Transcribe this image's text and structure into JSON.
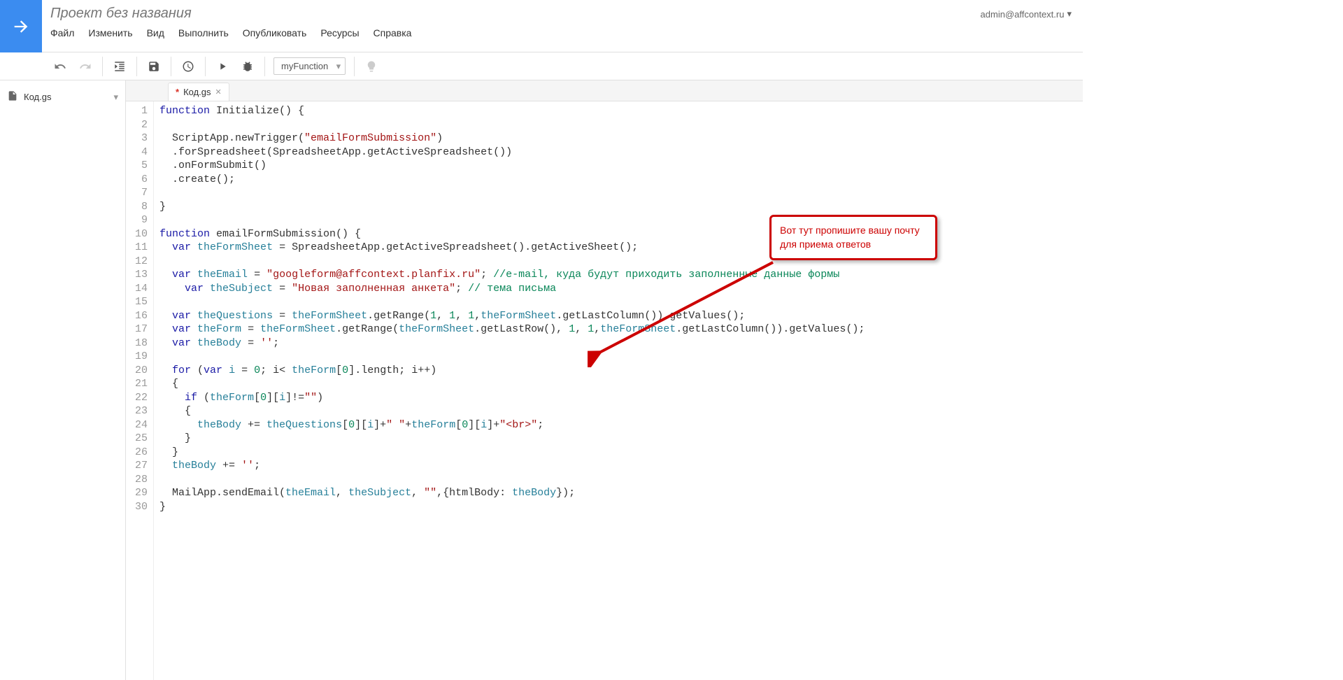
{
  "header": {
    "project_title": "Проект без названия",
    "user_email": "admin@affcontext.ru"
  },
  "menu": {
    "file": "Файл",
    "edit": "Изменить",
    "view": "Вид",
    "run": "Выполнить",
    "publish": "Опубликовать",
    "resources": "Ресурсы",
    "help": "Справка"
  },
  "toolbar": {
    "func_name": "myFunction"
  },
  "sidebar": {
    "file": "Код.gs"
  },
  "tab": {
    "name": "Код.gs",
    "modified": "*"
  },
  "callout": {
    "text": "Вот тут пропишите вашу почту для приема ответов"
  },
  "code": {
    "lines": [
      {
        "n": "1",
        "h": "<span class='kw'>function</span> Initialize() {"
      },
      {
        "n": "2",
        "h": ""
      },
      {
        "n": "3",
        "h": "  ScriptApp.newTrigger(<span class='str'>\"emailFormSubmission\"</span>)"
      },
      {
        "n": "4",
        "h": "  .forSpreadsheet(SpreadsheetApp.getActiveSpreadsheet())"
      },
      {
        "n": "5",
        "h": "  .onFormSubmit()"
      },
      {
        "n": "6",
        "h": "  .create();"
      },
      {
        "n": "7",
        "h": ""
      },
      {
        "n": "8",
        "h": "}"
      },
      {
        "n": "9",
        "h": ""
      },
      {
        "n": "10",
        "h": "<span class='kw'>function</span> emailFormSubmission() {"
      },
      {
        "n": "11",
        "h": "  <span class='kw'>var</span> <span class='ident'>theFormSheet</span> = SpreadsheetApp.getActiveSpreadsheet().getActiveSheet();"
      },
      {
        "n": "12",
        "h": ""
      },
      {
        "n": "13",
        "h": "  <span class='kw'>var</span> <span class='ident'>theEmail</span> = <span class='str'>\"googleform@affcontext.planfix.ru\"</span>; <span class='com'>//e-mail, куда будут приходить заполненные данные формы</span>"
      },
      {
        "n": "14",
        "h": "    <span class='kw'>var</span> <span class='ident'>theSubject</span> = <span class='str'>\"Новая заполненная анкета\"</span>; <span class='com'>// тема письма</span>"
      },
      {
        "n": "15",
        "h": ""
      },
      {
        "n": "16",
        "h": "  <span class='kw'>var</span> <span class='ident'>theQuestions</span> = <span class='ident'>theFormSheet</span>.getRange(<span class='num'>1</span>, <span class='num'>1</span>, <span class='num'>1</span>,<span class='ident'>theFormSheet</span>.getLastColumn()).getValues();"
      },
      {
        "n": "17",
        "h": "  <span class='kw'>var</span> <span class='ident'>theForm</span> = <span class='ident'>theFormSheet</span>.getRange(<span class='ident'>theFormSheet</span>.getLastRow(), <span class='num'>1</span>, <span class='num'>1</span>,<span class='ident'>theFormSheet</span>.getLastColumn()).getValues();"
      },
      {
        "n": "18",
        "h": "  <span class='kw'>var</span> <span class='ident'>theBody</span> = <span class='str'>''</span>;"
      },
      {
        "n": "19",
        "h": ""
      },
      {
        "n": "20",
        "h": "  <span class='kw'>for</span> (<span class='kw'>var</span> <span class='ident'>i</span> = <span class='num'>0</span>; i&lt; <span class='ident'>theForm</span>[<span class='num'>0</span>].length; i++)"
      },
      {
        "n": "21",
        "h": "  {"
      },
      {
        "n": "22",
        "h": "    <span class='kw'>if</span> (<span class='ident'>theForm</span>[<span class='num'>0</span>][<span class='ident'>i</span>]!=<span class='str'>\"\"</span>)"
      },
      {
        "n": "23",
        "h": "    {"
      },
      {
        "n": "24",
        "h": "      <span class='ident'>theBody</span> += <span class='ident'>theQuestions</span>[<span class='num'>0</span>][<span class='ident'>i</span>]+<span class='str'>\" \"</span>+<span class='ident'>theForm</span>[<span class='num'>0</span>][<span class='ident'>i</span>]+<span class='str'>\"&lt;br&gt;\"</span>;"
      },
      {
        "n": "25",
        "h": "    }"
      },
      {
        "n": "26",
        "h": "  }"
      },
      {
        "n": "27",
        "h": "  <span class='ident'>theBody</span> += <span class='str'>''</span>;"
      },
      {
        "n": "28",
        "h": ""
      },
      {
        "n": "29",
        "h": "  MailApp.sendEmail(<span class='ident'>theEmail</span>, <span class='ident'>theSubject</span>, <span class='str'>\"\"</span>,{htmlBody: <span class='ident'>theBody</span>});"
      },
      {
        "n": "30",
        "h": "}"
      }
    ]
  }
}
